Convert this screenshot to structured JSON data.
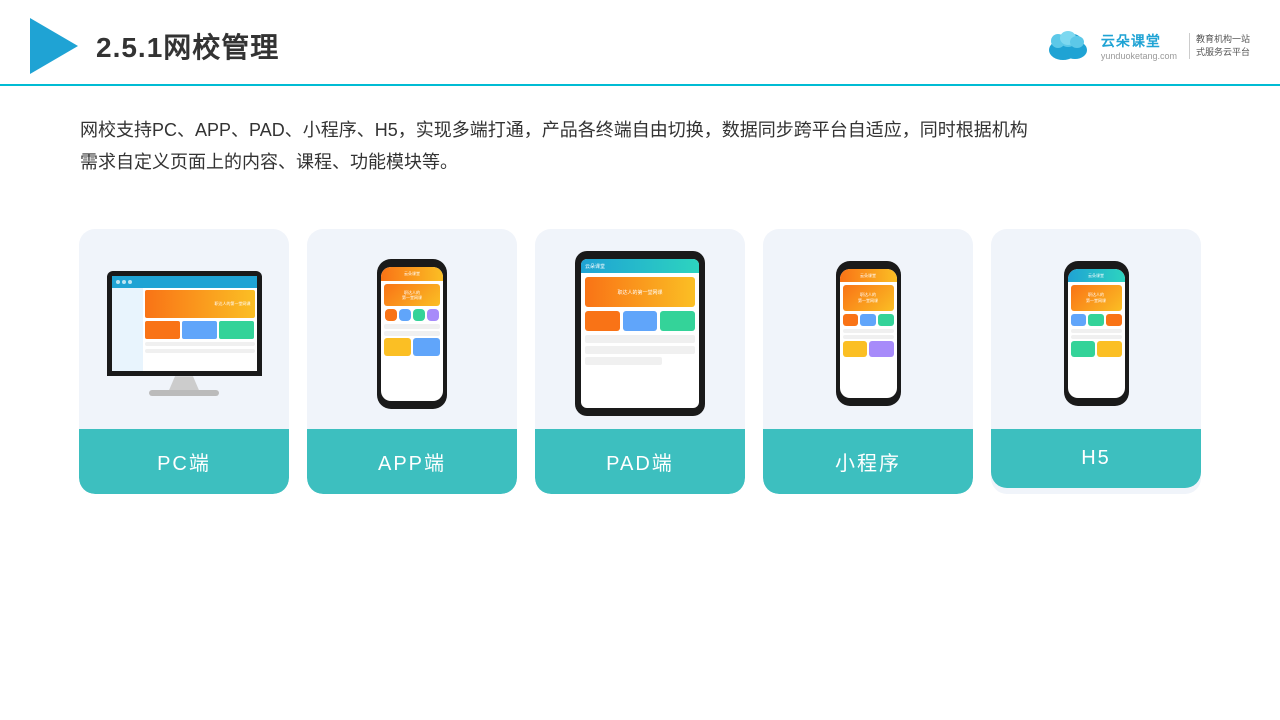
{
  "header": {
    "title": "2.5.1网校管理",
    "logo": {
      "name": "云朵课堂",
      "url": "yunduoketang.com",
      "slogan": "教育机构一站\n式服务云平台"
    }
  },
  "description": "网校支持PC、APP、PAD、小程序、H5，实现多端打通，产品各终端自由切换，数据同步跨平台自适应，同时根据机构\n需求自定义页面上的内容、课程、功能模块等。",
  "cards": [
    {
      "id": "pc",
      "label": "PC端"
    },
    {
      "id": "app",
      "label": "APP端"
    },
    {
      "id": "pad",
      "label": "PAD端"
    },
    {
      "id": "miniapp",
      "label": "小程序"
    },
    {
      "id": "h5",
      "label": "H5"
    }
  ],
  "colors": {
    "accent": "#3dbfbf",
    "header_border": "#00bcd4",
    "logo_color": "#1fa3d4"
  }
}
